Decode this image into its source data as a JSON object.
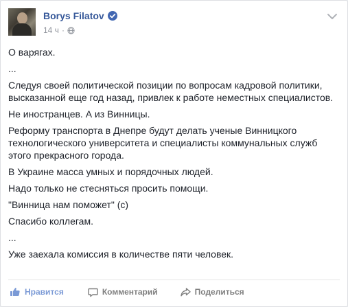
{
  "post": {
    "author": "Borys Filatov",
    "time": "14 ч",
    "separator": "·",
    "paragraphs": [
      "О варягах.",
      "...",
      "Следуя своей политической позиции по вопросам кадровой политики, высказанной еще год назад, привлек к работе неместных специалистов.",
      "Не иностранцев. А из Винницы.",
      "Реформу транспорта в Днепре будут делать ученые Винницкого технологического университета и специалисты коммунальных служб этого прекрасного города.",
      "В Украине масса умных и порядочных людей.",
      "Надо только не стесняться просить помощи.",
      "\"Винница нам поможет\" (с)",
      "Спасибо коллегам.",
      "...",
      "Уже заехала комиссия в количестве пяти человек."
    ]
  },
  "actions": {
    "like": "Нравится",
    "comment": "Комментарий",
    "share": "Поделиться"
  },
  "icons": {
    "verified": "verified-badge-icon",
    "audience": "globe-icon",
    "menu": "chevron-down-icon",
    "like": "thumbs-up-icon",
    "comment": "speech-bubble-icon",
    "share": "share-arrow-icon"
  },
  "colors": {
    "author_link": "#365899",
    "verified": "#4267b2",
    "meta": "#90949c",
    "like_action": "#7b9ad6",
    "action": "#7f7f7f"
  }
}
